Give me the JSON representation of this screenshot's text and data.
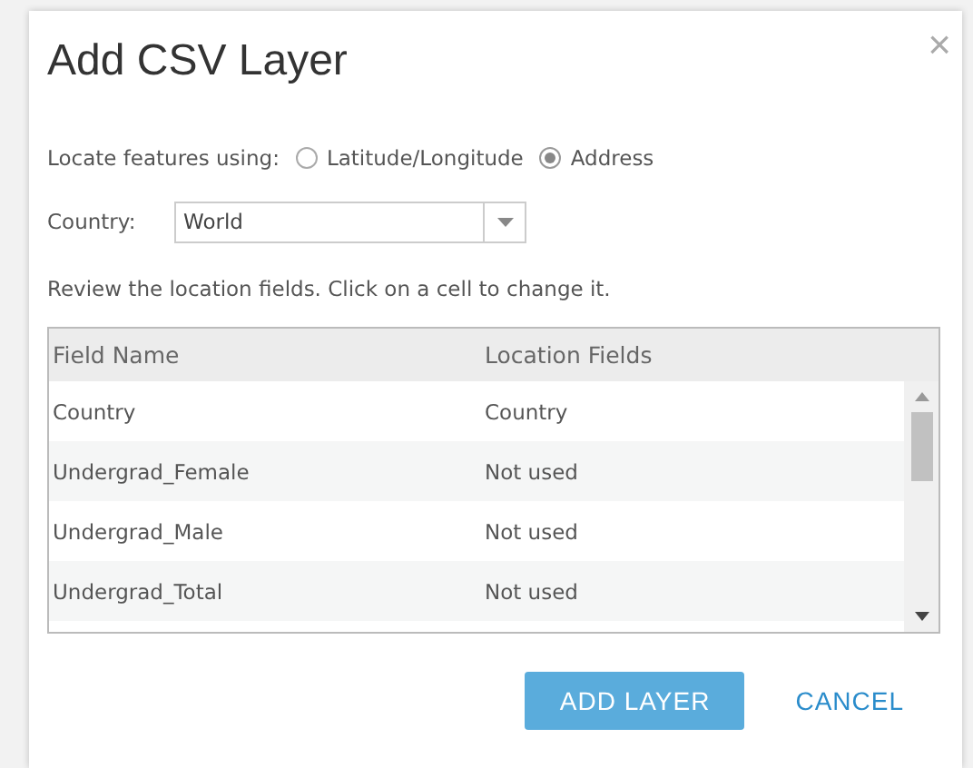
{
  "dialog": {
    "title": "Add CSV Layer",
    "close": "×"
  },
  "locate": {
    "label": "Locate features using:",
    "options": [
      {
        "label": "Latitude/Longitude",
        "selected": false
      },
      {
        "label": "Address",
        "selected": true
      }
    ]
  },
  "country": {
    "label": "Country:",
    "value": "World"
  },
  "instructions": "Review the location fields. Click on a cell to change it.",
  "table": {
    "columns": [
      "Field Name",
      "Location Fields"
    ],
    "rows": [
      {
        "field": "Country",
        "location": "Country"
      },
      {
        "field": "Undergrad_Female",
        "location": "Not used"
      },
      {
        "field": "Undergrad_Male",
        "location": "Not used"
      },
      {
        "field": "Undergrad_Total",
        "location": "Not used"
      }
    ]
  },
  "buttons": [
    {
      "label": "ADD LAYER",
      "kind": "primary"
    },
    {
      "label": "CANCEL",
      "kind": "link"
    }
  ]
}
